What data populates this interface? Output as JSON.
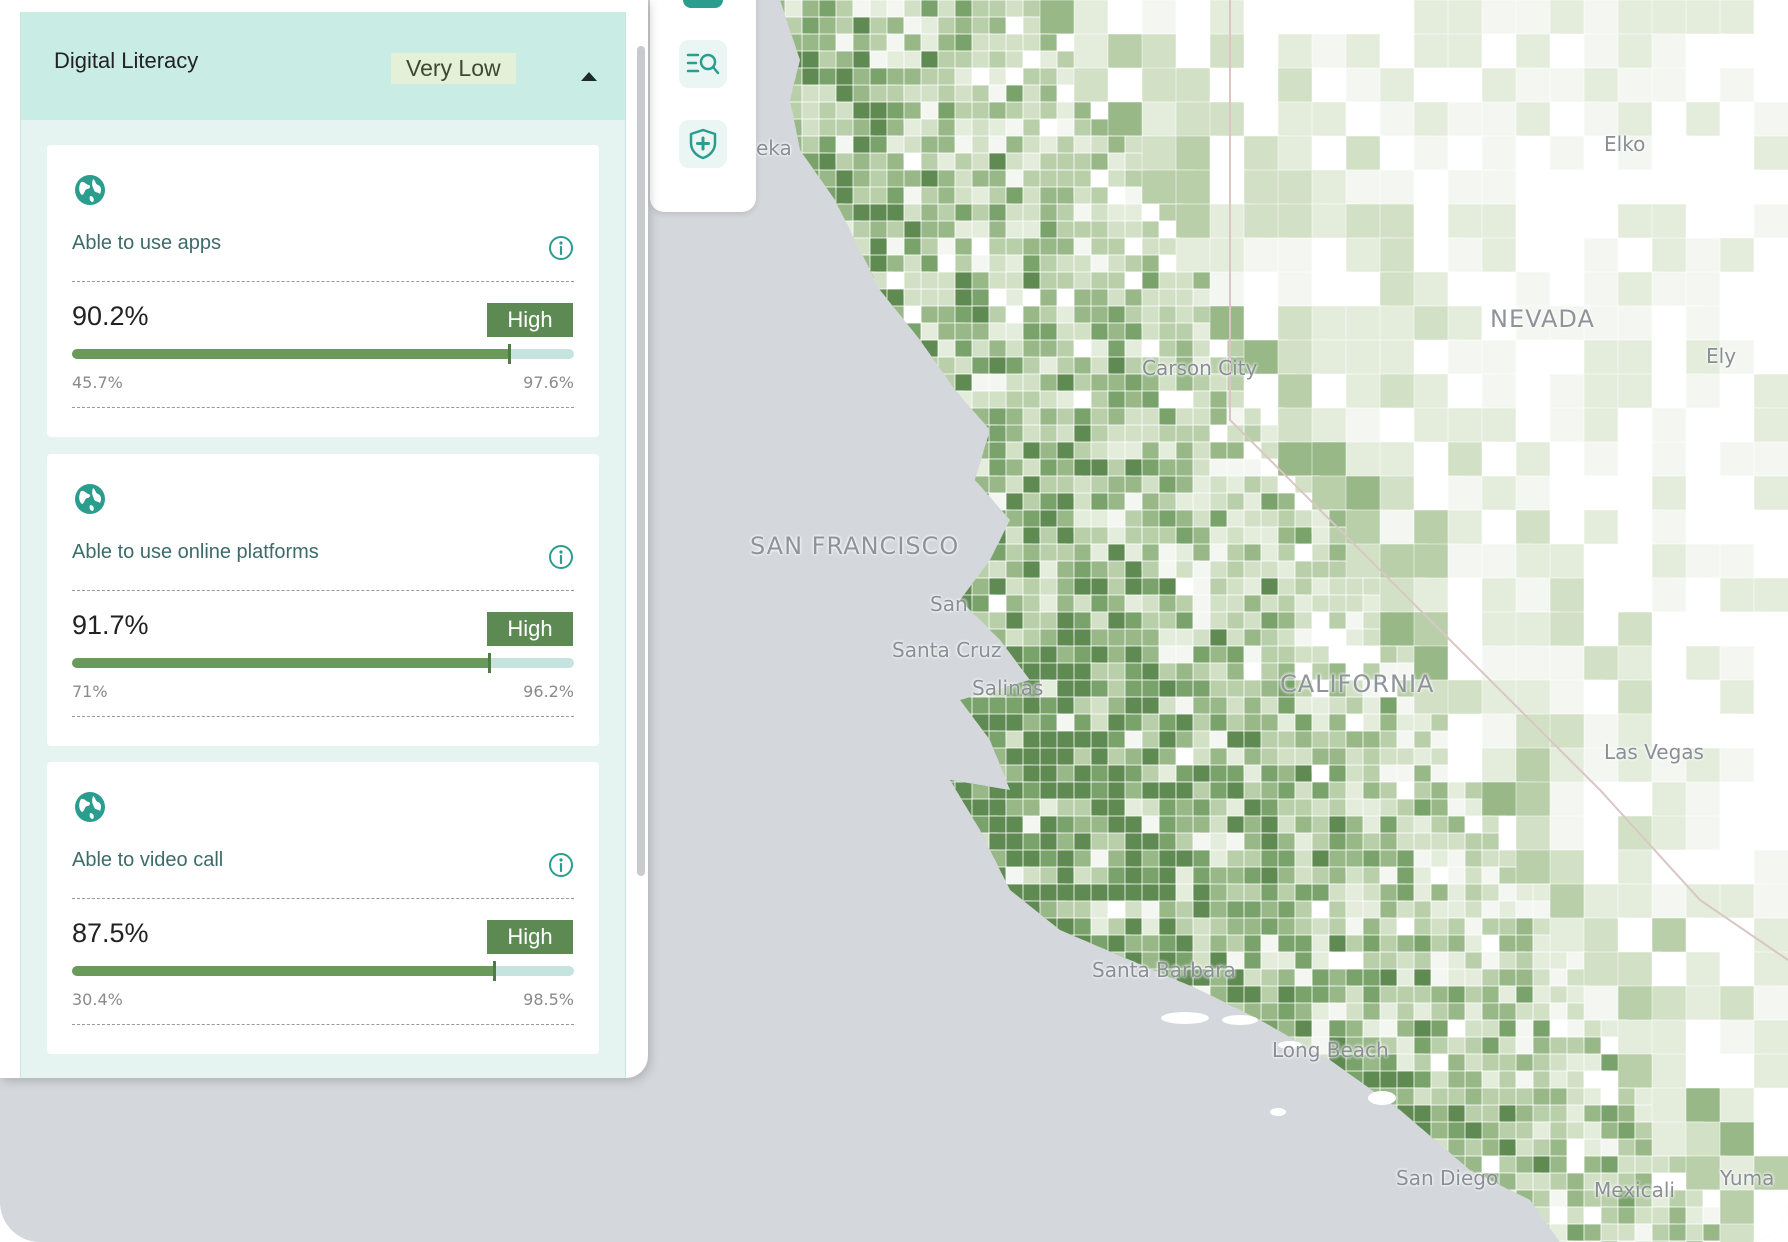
{
  "panel": {
    "section_title": "Digital Literacy",
    "section_level": "Very Low",
    "cards": [
      {
        "label": "Able to use apps",
        "value": "90.2%",
        "rating": "High",
        "min": "45.7%",
        "max": "97.6%",
        "fill_fraction": 0.87
      },
      {
        "label": "Able to use online platforms",
        "value": "91.7%",
        "rating": "High",
        "min": "71%",
        "max": "96.2%",
        "fill_fraction": 0.83
      },
      {
        "label": "Able to video call",
        "value": "87.5%",
        "rating": "High",
        "min": "30.4%",
        "max": "98.5%",
        "fill_fraction": 0.84
      }
    ]
  },
  "toolbar": {
    "icons": [
      "layers-icon",
      "search-list-icon",
      "health-shield-icon"
    ]
  },
  "map": {
    "labels": {
      "eureka": "eka",
      "elko": "Elko",
      "nevada": "NEVADA",
      "ely": "Ely",
      "carson": "Carson City",
      "sf": "SAN FRANCISCO",
      "sanjose": "San",
      "santacruz": "Santa Cruz",
      "salinas": "Salinas",
      "california": "CALIFORNIA",
      "lasvegas": "Las Vegas",
      "santabarbara": "Santa Barbara",
      "longbeach": "Long Beach",
      "sandiego": "San Diego",
      "mexicali": "Mexicali",
      "yuma": "Yuma"
    }
  },
  "colors": {
    "accent": "#2a9d8f",
    "rating": "#5c8a52",
    "bar_fill": "#6a9a5a",
    "bar_track": "#c5e4df",
    "header_bg": "#c9ede5",
    "panel_bg": "#e6f4f1",
    "ocean": "#d4d7db"
  }
}
